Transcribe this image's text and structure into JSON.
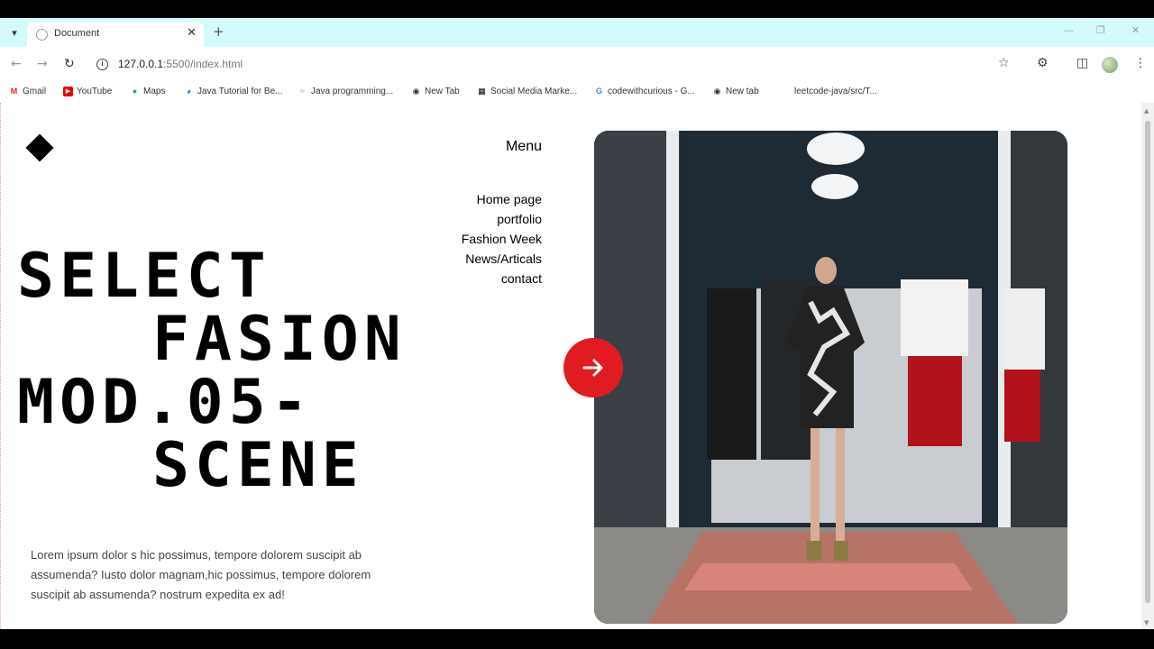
{
  "browser": {
    "tab_title": "Document",
    "url_host": "127.0.0.1",
    "url_path": ":5500/index.html"
  },
  "bookmarks": [
    {
      "label": "Gmail",
      "icon": "gmail-icon"
    },
    {
      "label": "YouTube",
      "icon": "youtube-icon"
    },
    {
      "label": "Maps",
      "icon": "maps-icon"
    },
    {
      "label": "Java Tutorial for Be...",
      "icon": "globe-icon"
    },
    {
      "label": "Java programming...",
      "icon": "bookmark-icon"
    },
    {
      "label": "New Tab",
      "icon": "globe-icon"
    },
    {
      "label": "Social Media Marke...",
      "icon": "site-icon"
    },
    {
      "label": "codewithcurious - G...",
      "icon": "google-icon"
    },
    {
      "label": "New tab",
      "icon": "globe-icon"
    },
    {
      "label": "leetcode-java/src/T...",
      "icon": "bookmark-icon"
    }
  ],
  "page": {
    "menu_title": "Menu",
    "nav": [
      "Home page",
      "portfolio",
      "Fashion Week",
      "News/Articals",
      "contact"
    ],
    "hero_lines": [
      "SELECT",
      "FASION",
      "MOD.05-",
      "SCENE"
    ],
    "description": "Lorem ipsum dolor s hic possimus, tempore dolorem suscipit ab assumenda? Iusto dolor magnam,hic possimus, tempore dolorem suscipit ab assumenda? nostrum expedita ex ad!",
    "accent_color": "#e11b22"
  }
}
